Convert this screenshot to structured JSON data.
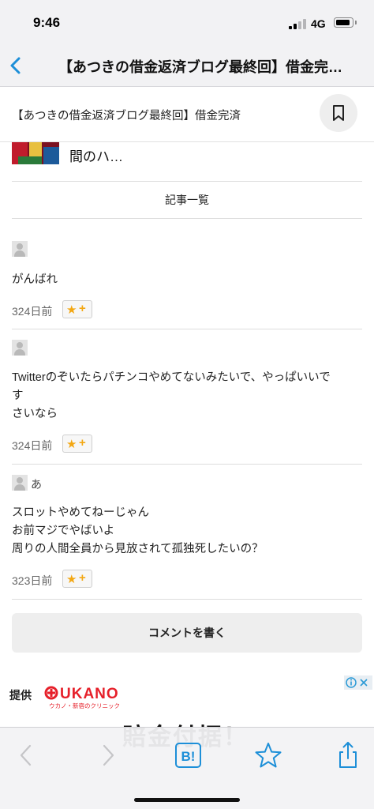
{
  "status": {
    "time": "9:46",
    "network": "4G"
  },
  "nav": {
    "title": "【あつきの借金返済ブログ最終回】借金完…"
  },
  "titlebar": {
    "text": "【あつきの借金返済ブログ最終回】借金完済"
  },
  "related": {
    "title": "間のハ…"
  },
  "article_list": "記事一覧",
  "comments": [
    {
      "author": "",
      "lines": [
        "がんばれ"
      ],
      "date": "324日前"
    },
    {
      "author": "",
      "lines": [
        "Twitterのぞいたらパチンコやめてないみたいで、やっぱいいで",
        "す",
        "さいなら"
      ],
      "date": "324日前"
    },
    {
      "author": "あ",
      "lines": [
        "スロットやめてねーじゃん",
        "お前マジでやばいよ",
        "周りの人間全員から見放されて孤独死したいの？"
      ],
      "date": "323日前"
    }
  ],
  "star_button": {
    "plus": "+"
  },
  "write_comment": "コメントを書く",
  "ad": {
    "label": "提供",
    "brand": "UKANO",
    "tagline": "ウカノ・新宿のクリニック",
    "headline": "賠金付据！"
  },
  "toolbar": {
    "hatena_label": "B!"
  },
  "colors": {
    "accent": "#1d8fd8",
    "star": "#f3a712",
    "brand_red": "#e6202a"
  }
}
